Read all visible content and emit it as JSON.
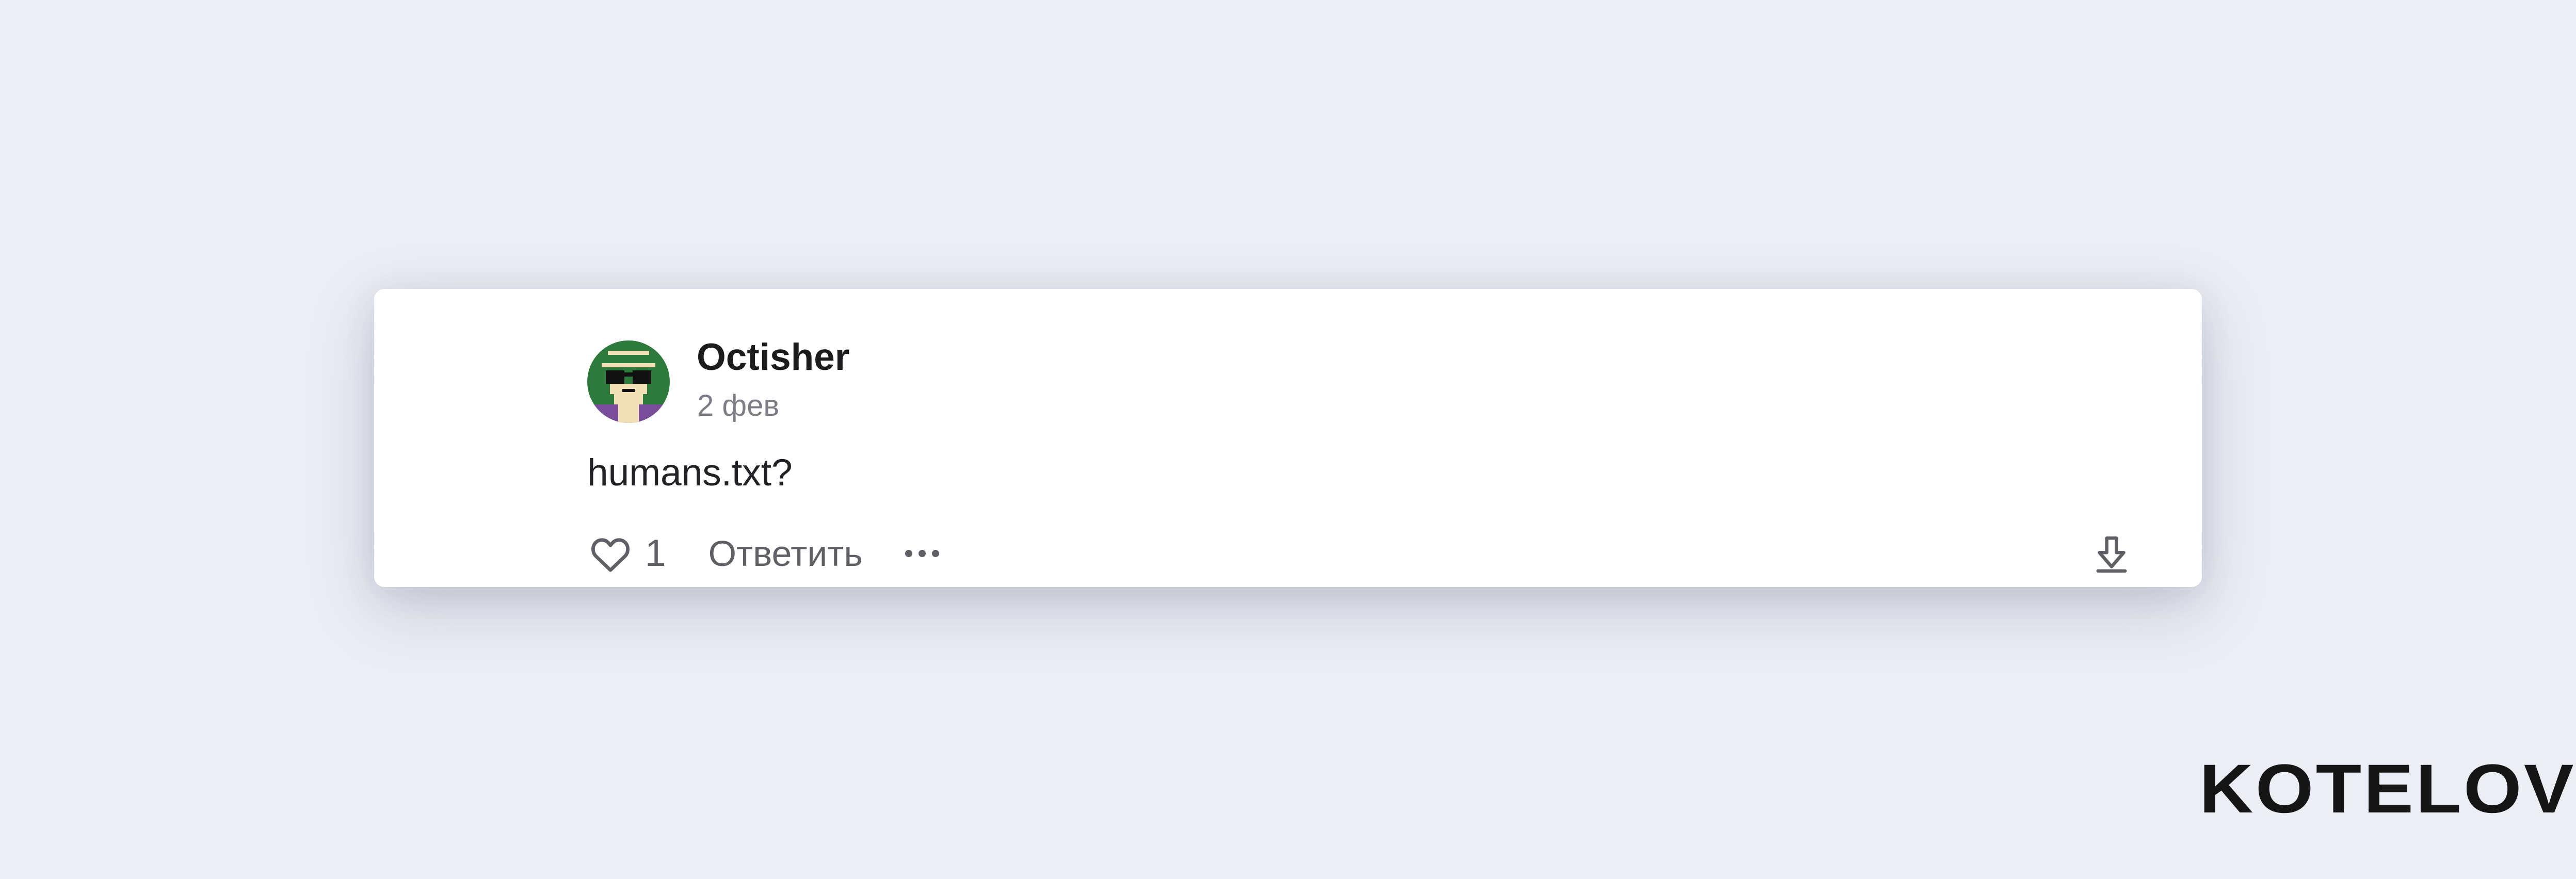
{
  "comment": {
    "author": "Octisher",
    "date": "2 фев",
    "text": "humans.txt?",
    "like_count": "1",
    "reply_label": "Ответить",
    "icons": {
      "like": "heart-outline-icon",
      "more": "more-horizontal-icon",
      "download": "arrow-down-outline-icon"
    },
    "avatar": {
      "description": "pixel-art avatar with sunglasses",
      "colors": {
        "background": "#2e7a3c",
        "bottom": "#7a4d9b",
        "skin": "#f1e0b6",
        "glasses": "#111111"
      }
    }
  },
  "brand": {
    "logo_text": "KOTELOV"
  },
  "colors": {
    "page_background": "#eceef5",
    "card_background": "#ffffff",
    "primary_text": "#1c1c1e",
    "secondary_text": "#7c7c84",
    "action_text": "#5f5f66"
  }
}
